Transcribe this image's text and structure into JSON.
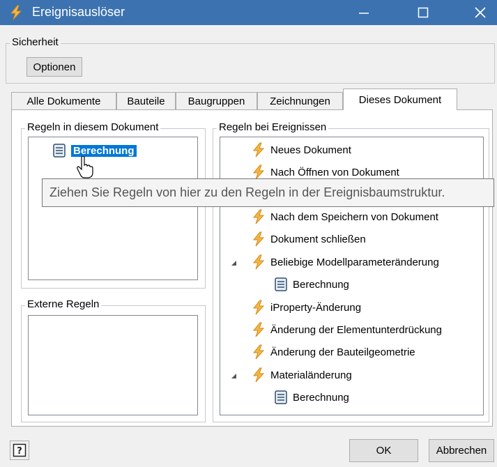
{
  "window": {
    "title": "Ereignisauslöser"
  },
  "security": {
    "legend": "Sicherheit",
    "options_label": "Optionen"
  },
  "tabs": [
    {
      "label": "Alle Dokumente"
    },
    {
      "label": "Bauteile"
    },
    {
      "label": "Baugruppen"
    },
    {
      "label": "Zeichnungen"
    },
    {
      "label": "Dieses Dokument"
    }
  ],
  "document_rules": {
    "legend": "Regeln in diesem Dokument",
    "items": [
      {
        "label": "Berechnung"
      }
    ]
  },
  "external_rules": {
    "legend": "Externe Regeln"
  },
  "event_rules": {
    "legend": "Regeln bei Ereignissen",
    "items": [
      {
        "label": "Neues Dokument"
      },
      {
        "label": "Nach Öffnen von Dokument"
      },
      {
        "label": "Nach dem Speichern von Dokument"
      },
      {
        "label": "Dokument schließen"
      },
      {
        "label": "Beliebige Modellparameteränderung"
      },
      {
        "label": "Berechnung"
      },
      {
        "label": "iProperty-Änderung"
      },
      {
        "label": "Änderung der Elementunterdrückung"
      },
      {
        "label": "Änderung der Bauteilgeometrie"
      },
      {
        "label": "Materialänderung"
      },
      {
        "label": "Berechnung"
      }
    ]
  },
  "tooltip": {
    "text": "Ziehen Sie Regeln von hier zu den Regeln in der Ereignisbaumstruktur."
  },
  "footer": {
    "ok_label": "OK",
    "cancel_label": "Abbrechen"
  },
  "colors": {
    "titlebar": "#3c72b0",
    "selection": "#0078d7",
    "event_icon": "#f5b843"
  }
}
